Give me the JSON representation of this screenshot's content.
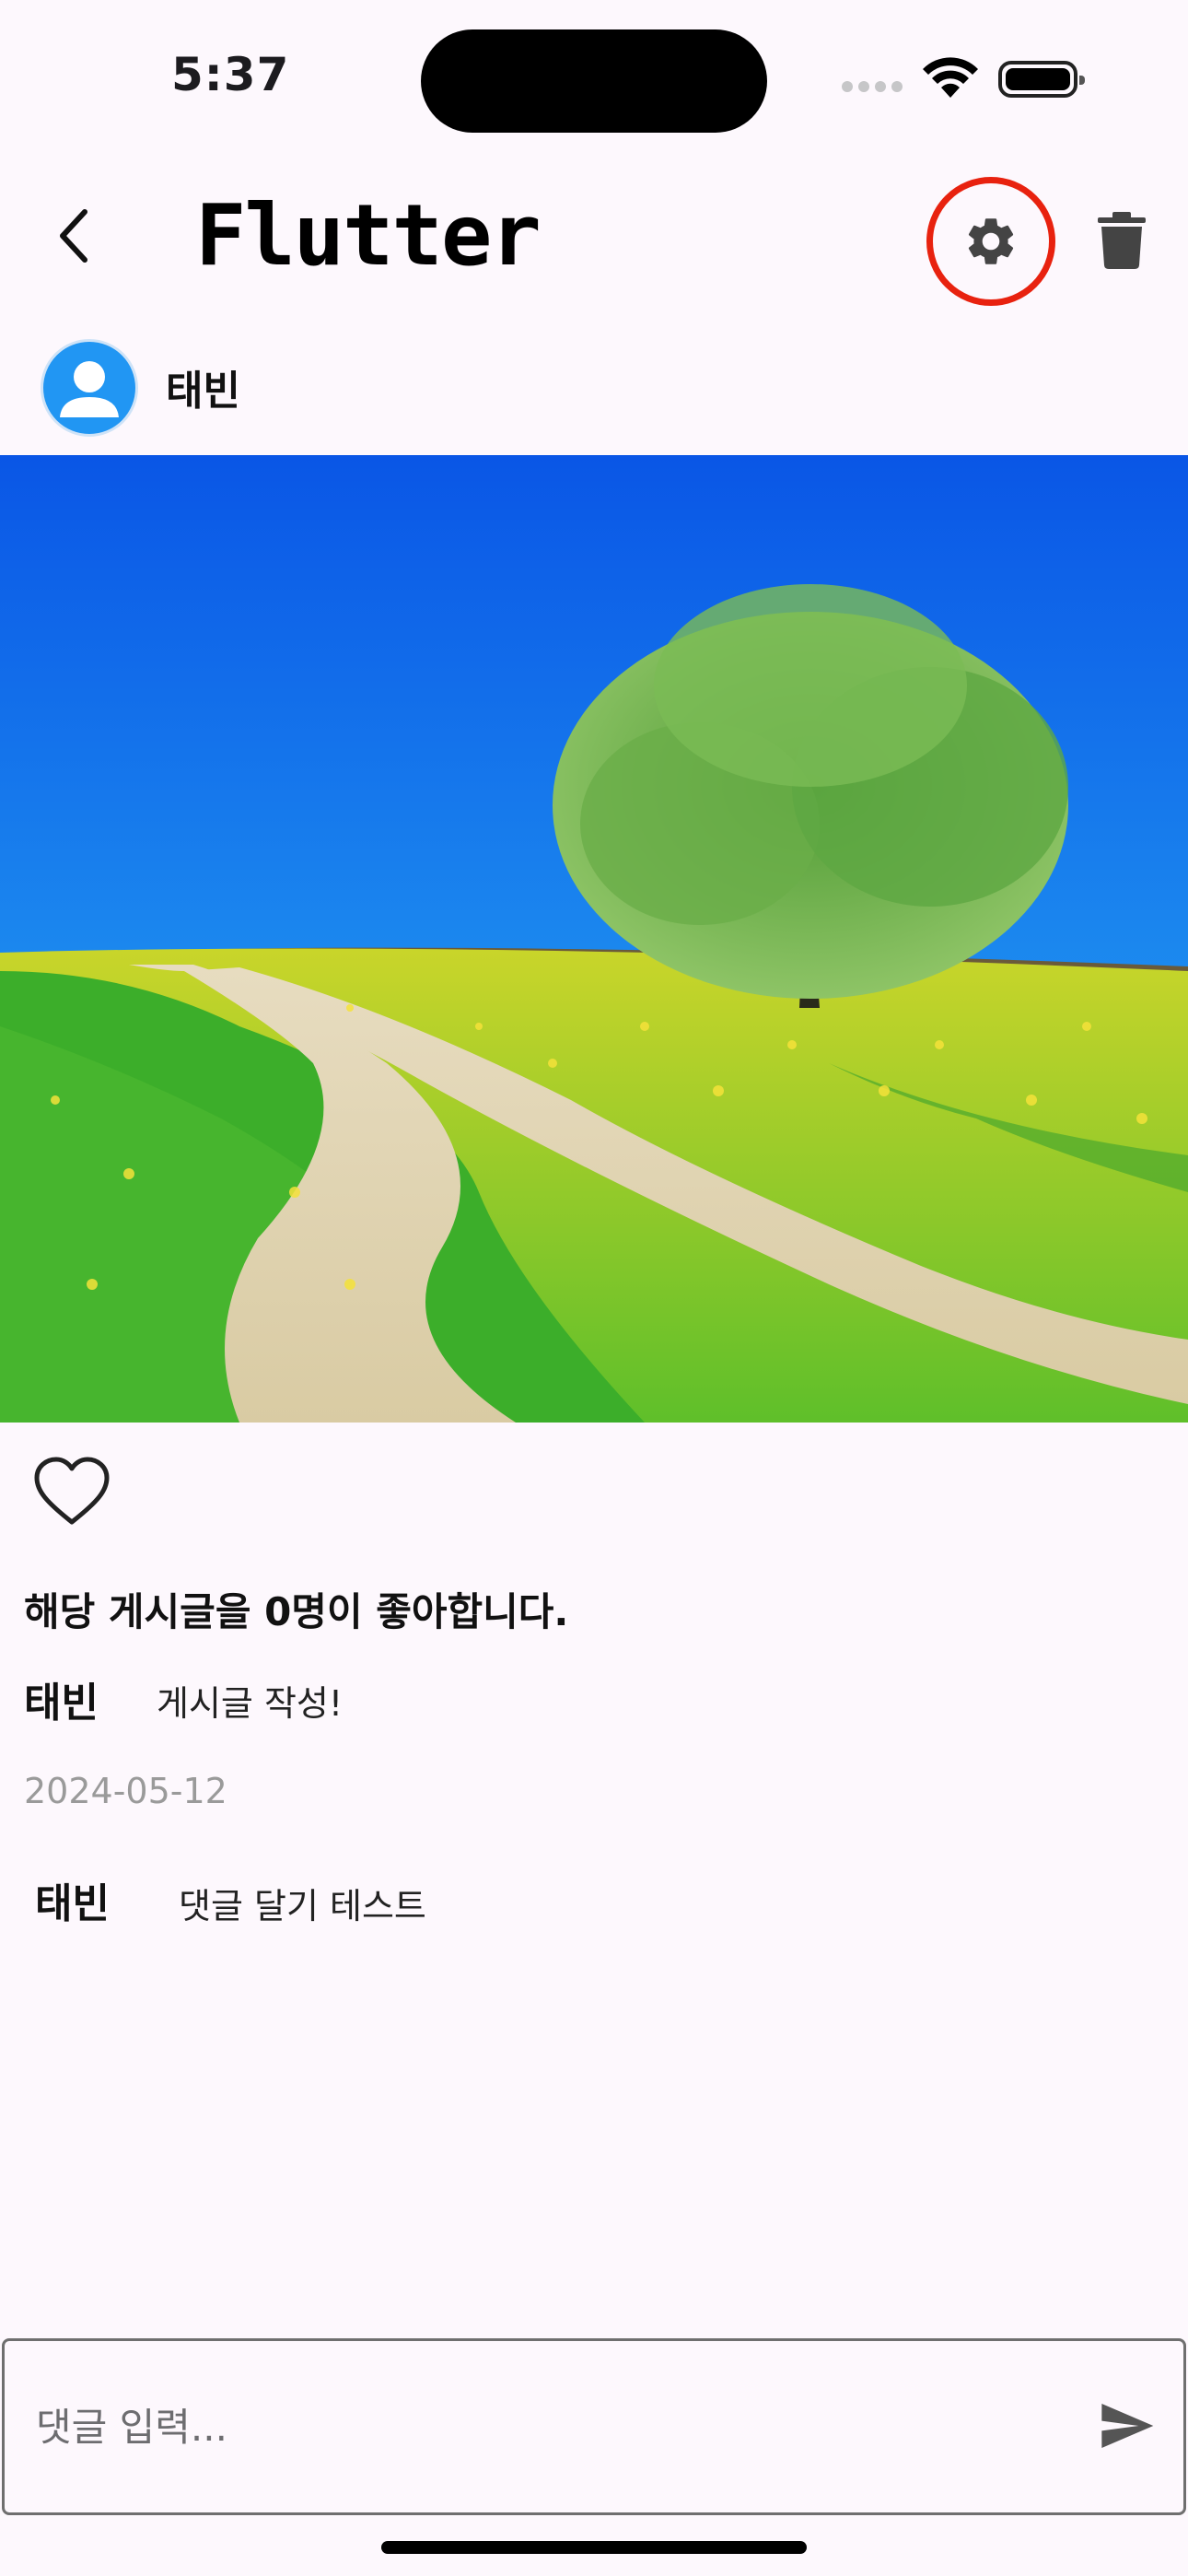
{
  "status_bar": {
    "time": "5:37"
  },
  "app_bar": {
    "title": "Flutter",
    "icons": [
      "back-arrow-icon",
      "gear-icon",
      "trash-icon"
    ]
  },
  "post": {
    "author": "태빈",
    "image_description_icon": "photo",
    "likes_text": "해당 게시글을 0명이 좋아합니다.",
    "caption_author": "태빈",
    "caption": "게시글 작성!",
    "date": "2024-05-12"
  },
  "comments": [
    {
      "author": "태빈",
      "text": "댓글 달기 테스트"
    }
  ],
  "comment_input": {
    "placeholder": "댓글 입력...",
    "value": ""
  },
  "colors": {
    "background": "#fdf8fd",
    "highlight_ring": "#e8220f",
    "avatar": "#2196f3"
  }
}
